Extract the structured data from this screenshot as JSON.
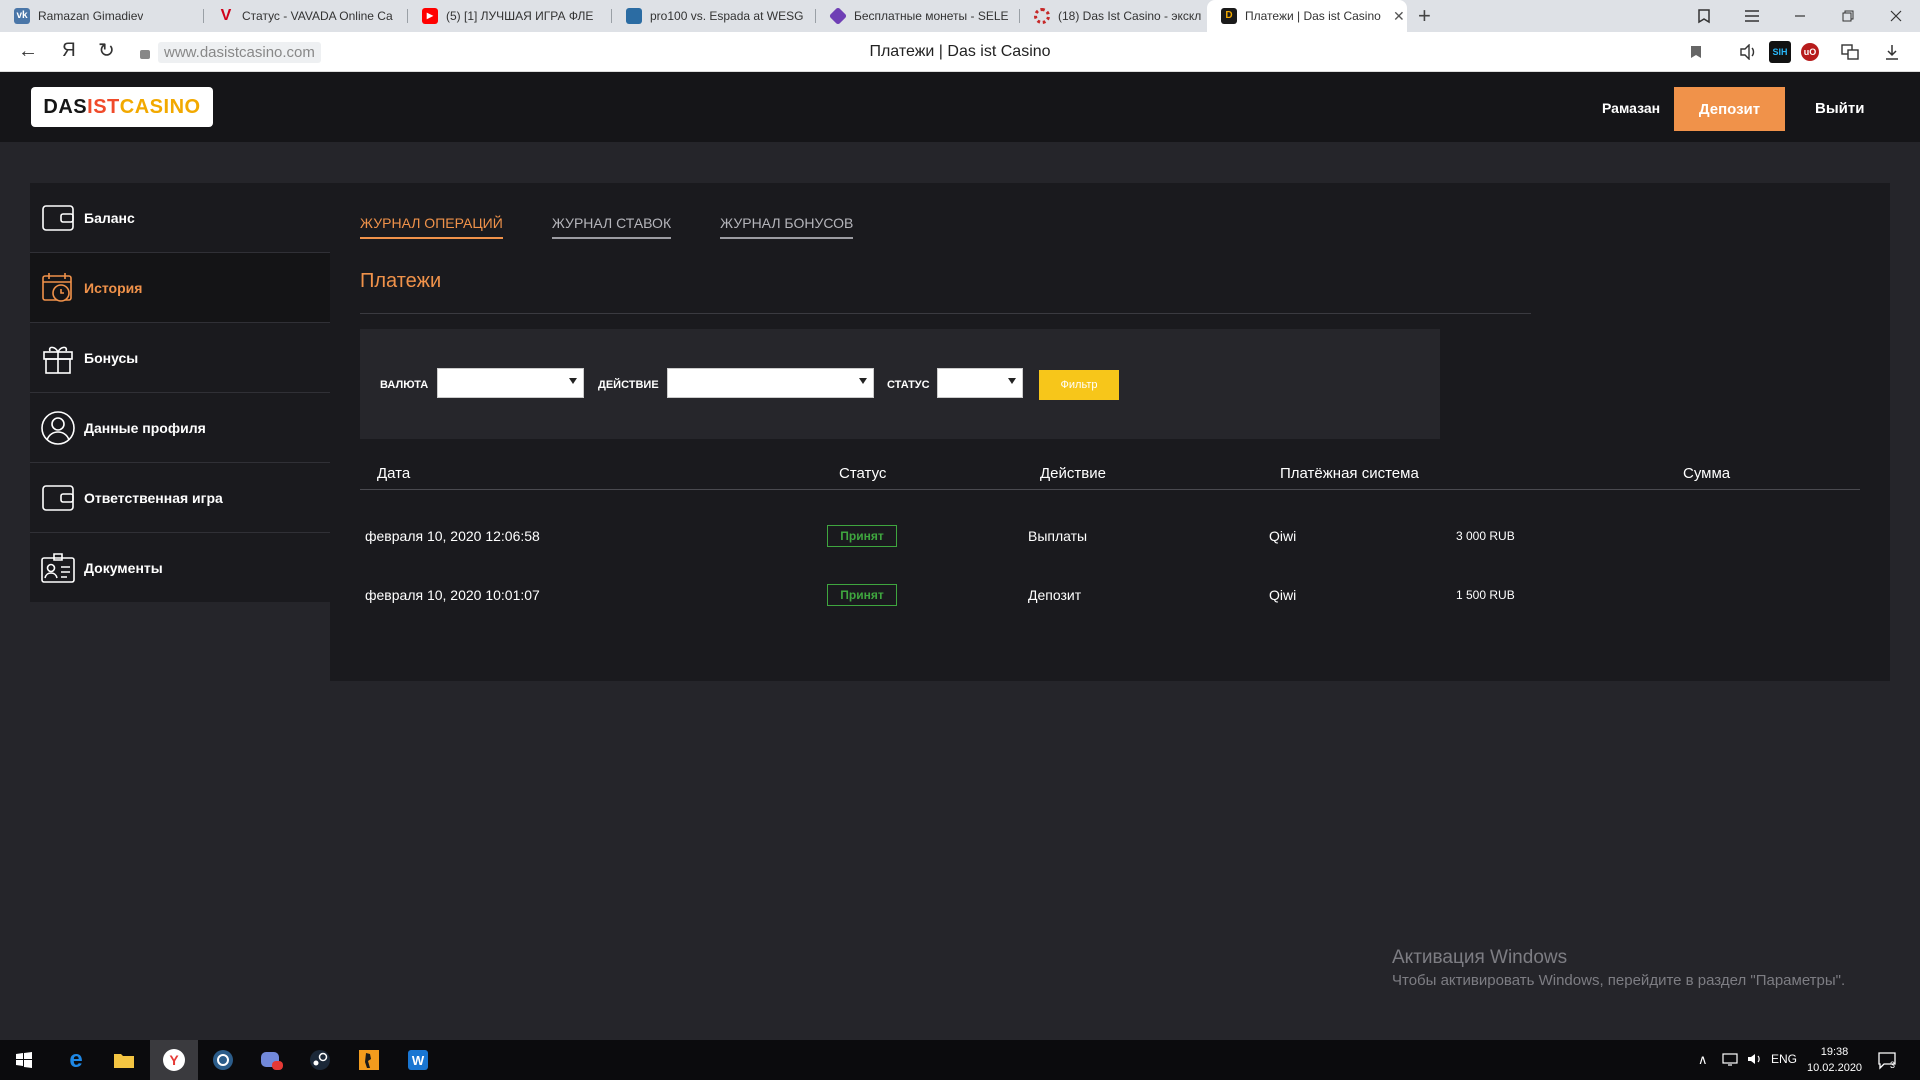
{
  "browser": {
    "tabs": [
      {
        "label": "Ramazan Gimadiev",
        "fav": "vk-icon",
        "favtext": "vk",
        "favcolor": "#4a76a8"
      },
      {
        "label": "Статус - VAVADA Online Ca",
        "fav": "vavada-icon",
        "favtext": "V",
        "favcolor": "#d0021b"
      },
      {
        "label": "(5) [1] ЛУЧШАЯ ИГРА ФЛЕ",
        "fav": "youtube-icon",
        "favtext": "▶",
        "favcolor": "#ff0000"
      },
      {
        "label": "pro100 vs. Espada at WESG",
        "fav": "hltv-icon",
        "favtext": "",
        "favcolor": "#2b6ca3"
      },
      {
        "label": "Бесплатные монеты - SELE",
        "fav": "selector-icon",
        "favtext": "",
        "favcolor": "#6f3fb5"
      },
      {
        "label": "(18) Das Ist Casino - экскл",
        "fav": "spinner-icon",
        "favtext": "",
        "favcolor": "#c62828"
      },
      {
        "label": "Платежи | Das ist Casino",
        "fav": "dasist-icon",
        "favtext": "D",
        "favcolor": "#1a1a1a",
        "active": true
      }
    ],
    "url": "www.dasistcasino.com",
    "page_title": "Платежи | Das ist Casino",
    "nav_back": "←",
    "nav_yandex": "Я",
    "nav_reload": "↻"
  },
  "header": {
    "logo": {
      "part1": "DAS",
      "part2": "IST",
      "part3": "CASINO"
    },
    "username": "Рамазан",
    "deposit_label": "Депозит",
    "logout_label": "Выйти"
  },
  "sidebar": {
    "items": [
      {
        "label": "Баланс",
        "icon": "wallet-icon"
      },
      {
        "label": "История",
        "icon": "calendar-clock-icon",
        "active": true
      },
      {
        "label": "Бонусы",
        "icon": "gift-icon"
      },
      {
        "label": "Данные профиля",
        "icon": "user-icon"
      },
      {
        "label": "Ответственная игра",
        "icon": "wallet-icon"
      },
      {
        "label": "Документы",
        "icon": "id-card-icon"
      }
    ]
  },
  "main": {
    "tabs": [
      {
        "label": "ЖУРНАЛ ОПЕРАЦИЙ",
        "active": true
      },
      {
        "label": "ЖУРНАЛ СТАВОК"
      },
      {
        "label": "ЖУРНАЛ БОНУСОВ"
      }
    ],
    "title": "Платежи",
    "filters": {
      "currency_label": "ВАЛЮТА",
      "currency_value": "",
      "action_label": "ДЕЙСТВИЕ",
      "action_value": "",
      "status_label": "СТАТУС",
      "status_value": "",
      "filter_button": "Фильтр"
    },
    "table": {
      "columns": [
        "Дата",
        "Статус",
        "Действие",
        "Платёжная система",
        "Сумма"
      ],
      "rows": [
        {
          "date": "февраля 10, 2020 12:06:58",
          "status": "Принят",
          "action": "Выплаты",
          "system": "Qiwi",
          "amount": "3 000 RUB"
        },
        {
          "date": "февраля 10, 2020 10:01:07",
          "status": "Принят",
          "action": "Депозит",
          "system": "Qiwi",
          "amount": "1 500 RUB"
        }
      ]
    }
  },
  "watermark": {
    "line1": "Активация Windows",
    "line2": "Чтобы активировать Windows, перейдите в раздел \"Параметры\"."
  },
  "taskbar": {
    "lang": "ENG",
    "time": "19:38",
    "date": "10.02.2020",
    "notifications": "3"
  }
}
